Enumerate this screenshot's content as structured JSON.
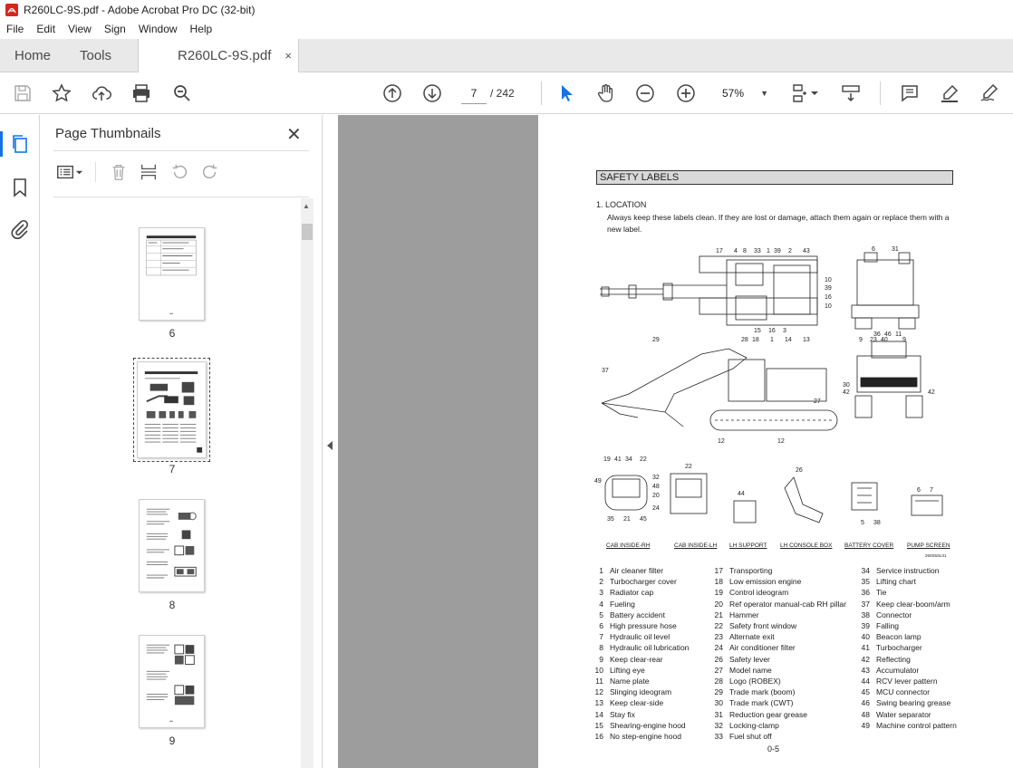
{
  "window": {
    "title": "R260LC-9S.pdf - Adobe Acrobat Pro DC (32-bit)"
  },
  "menu": [
    "File",
    "Edit",
    "View",
    "Sign",
    "Window",
    "Help"
  ],
  "tabs": {
    "home": "Home",
    "tools": "Tools",
    "document": "R260LC-9S.pdf",
    "close": "×"
  },
  "toolbar": {
    "current_page": "7",
    "total_pages": "/ 242",
    "zoom": "57%"
  },
  "panel": {
    "title": "Page Thumbnails",
    "close": "✕",
    "thumbnails": [
      {
        "label": "6"
      },
      {
        "label": "7",
        "selected": true
      },
      {
        "label": "8"
      },
      {
        "label": "9"
      }
    ]
  },
  "page": {
    "section_title": "SAFETY LABELS",
    "location_heading": "1.  LOCATION",
    "location_text": "Always keep these labels clean.  If they are lost or damage, attach them again or replace them with a new label.",
    "figure_code": "260S5SL01",
    "captions": [
      "CAB INSIDE-RH",
      "CAB INSIDE-LH",
      "LH SUPPORT",
      "LH CONSOLE BOX",
      "BATTERY COVER",
      "PUMP SCREEN"
    ],
    "callouts": {
      "top_view": [
        "17",
        "4",
        "8",
        "33",
        "1",
        "39",
        "2",
        "43",
        "10",
        "39",
        "16",
        "10",
        "15",
        "16",
        "3"
      ],
      "rear_view": [
        "6",
        "31",
        "36",
        "46",
        "11"
      ],
      "side_view": [
        "29",
        "28",
        "18",
        "1",
        "14",
        "13",
        "37",
        "27",
        "12",
        "12"
      ],
      "front_view": [
        "9",
        "23",
        "40",
        "9",
        "30",
        "42",
        "42"
      ],
      "details": [
        "19",
        "41",
        "34",
        "22",
        "49",
        "32",
        "48",
        "20",
        "24",
        "35",
        "21",
        "45",
        "22",
        "44",
        "26",
        "5",
        "38",
        "6",
        "7"
      ]
    },
    "legend": [
      [
        "1",
        "Air cleaner filter"
      ],
      [
        "2",
        "Turbocharger cover"
      ],
      [
        "3",
        "Radiator cap"
      ],
      [
        "4",
        "Fueling"
      ],
      [
        "5",
        "Battery accident"
      ],
      [
        "6",
        "High pressure hose"
      ],
      [
        "7",
        "Hydraulic oil level"
      ],
      [
        "8",
        "Hydraulic oil lubrication"
      ],
      [
        "9",
        "Keep clear-rear"
      ],
      [
        "10",
        "Lifting eye"
      ],
      [
        "11",
        "Name plate"
      ],
      [
        "12",
        "Slinging ideogram"
      ],
      [
        "13",
        "Keep clear-side"
      ],
      [
        "14",
        "Stay fix"
      ],
      [
        "15",
        "Shearing-engine hood"
      ],
      [
        "16",
        "No step-engine hood"
      ],
      [
        "17",
        "Transporting"
      ],
      [
        "18",
        "Low emission engine"
      ],
      [
        "19",
        "Control ideogram"
      ],
      [
        "20",
        "Ref operator manual-cab RH pillar"
      ],
      [
        "21",
        "Hammer"
      ],
      [
        "22",
        "Safety front window"
      ],
      [
        "23",
        "Alternate exit"
      ],
      [
        "24",
        "Air conditioner filter"
      ],
      [
        "26",
        "Safety lever"
      ],
      [
        "27",
        "Model name"
      ],
      [
        "28",
        "Logo (ROBEX)"
      ],
      [
        "29",
        "Trade mark (boom)"
      ],
      [
        "30",
        "Trade mark (CWT)"
      ],
      [
        "31",
        "Reduction gear grease"
      ],
      [
        "32",
        "Locking-clamp"
      ],
      [
        "33",
        "Fuel shut off"
      ],
      [
        "34",
        "Service instruction"
      ],
      [
        "35",
        "Lifting chart"
      ],
      [
        "36",
        "Tie"
      ],
      [
        "37",
        "Keep clear-boom/arm"
      ],
      [
        "38",
        "Connector"
      ],
      [
        "39",
        "Falling"
      ],
      [
        "40",
        "Beacon lamp"
      ],
      [
        "41",
        "Turbocharger"
      ],
      [
        "42",
        "Reflecting"
      ],
      [
        "43",
        "Accumulator"
      ],
      [
        "44",
        "RCV lever pattern"
      ],
      [
        "45",
        "MCU connector"
      ],
      [
        "46",
        "Swing bearing grease"
      ],
      [
        "48",
        "Water separator"
      ],
      [
        "49",
        "Machine control pattern"
      ]
    ],
    "page_number": "0-5",
    "colors": {
      "accent": "#1473e6",
      "pdf_red": "#d7261e",
      "doc_bg": "#9d9d9d"
    }
  }
}
